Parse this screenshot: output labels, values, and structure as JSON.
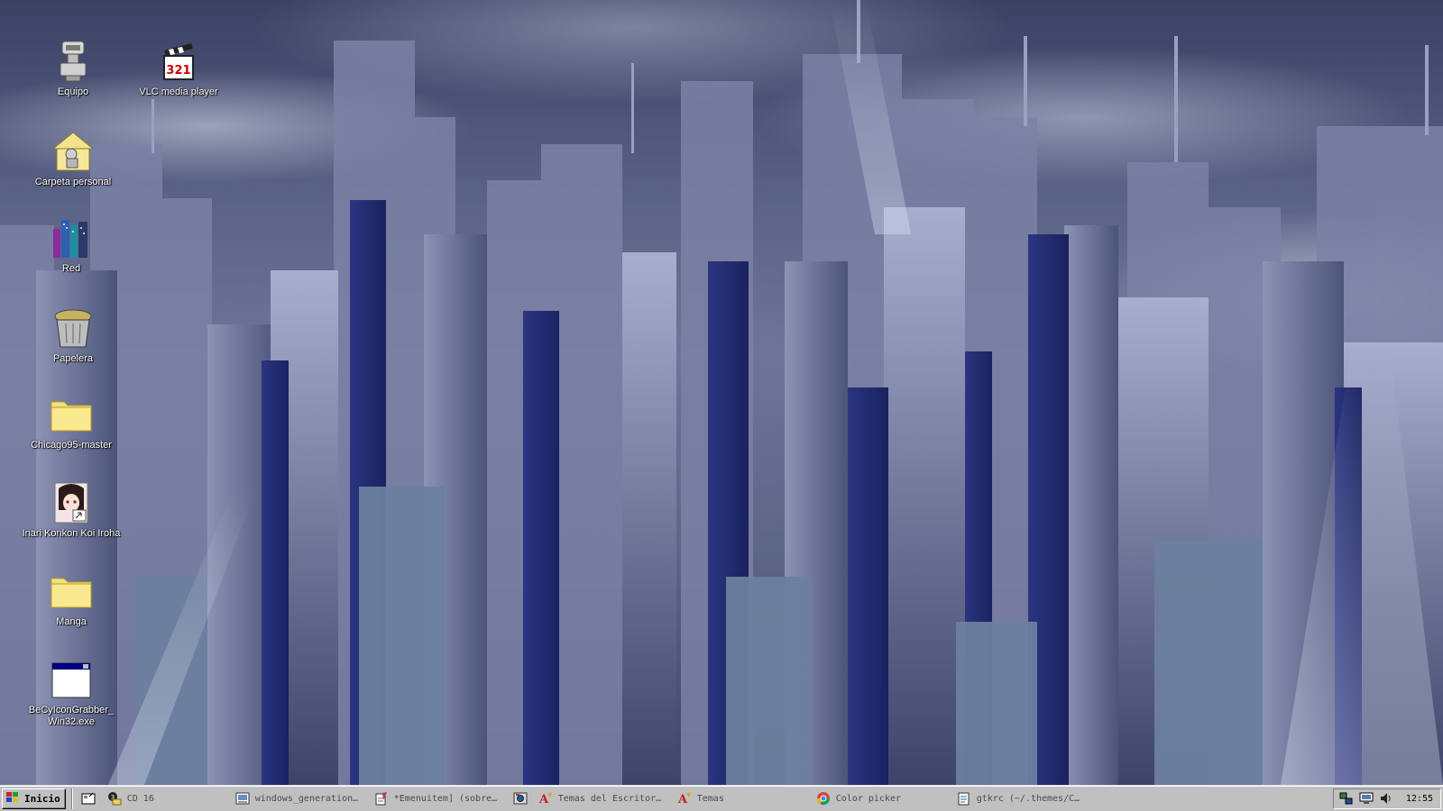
{
  "desktop": {
    "icons": [
      {
        "label": "Equipo",
        "icon": "computer-icon"
      },
      {
        "label": "VLC media player",
        "icon": "vlc-clapperboard-icon"
      },
      {
        "label": "Carpeta personal",
        "icon": "home-folder-icon"
      },
      {
        "label": "Red",
        "icon": "network-icon"
      },
      {
        "label": "Papelera",
        "icon": "trash-icon"
      },
      {
        "label": "Chicago95-master",
        "icon": "folder-icon"
      },
      {
        "label": "Inari Konkon Koi Iroha",
        "icon": "anime-shortcut-icon"
      },
      {
        "label": "Manga",
        "icon": "folder-icon"
      },
      {
        "label": "BeCyIconGrabber_\nWin32.exe",
        "icon": "executable-window-icon"
      }
    ]
  },
  "taskbar": {
    "start_label": "Inicio",
    "quick_launch": [
      "show-desktop-icon"
    ],
    "tasks": [
      {
        "label": "CD 16",
        "icon": "cd-icon"
      },
      {
        "label": "windows_generation…",
        "icon": "image-viewer-icon"
      },
      {
        "label": "*Emenuitem] (sobre…",
        "icon": "text-editor-icon"
      },
      {
        "label": "",
        "icon": "settings-icon"
      },
      {
        "label": "Temas del Escritor…",
        "icon": "themes-icon"
      },
      {
        "label": "Temas",
        "icon": "themes-icon"
      },
      {
        "label": "Color picker",
        "icon": "chrome-icon"
      },
      {
        "label": "gtkrc (~/.themes/C…",
        "icon": "text-file-icon"
      }
    ],
    "tray": {
      "icons": [
        "network-tray-icon",
        "display-tray-icon",
        "volume-icon"
      ],
      "clock": "12:55"
    }
  },
  "colors": {
    "taskbar": "#c0c0c0",
    "icon_label": "#ffffff",
    "sky": "#5a6286"
  }
}
